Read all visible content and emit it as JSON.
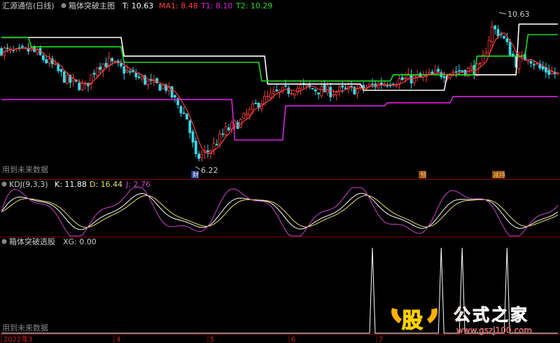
{
  "colors": {
    "background": "#000000",
    "up": "#ff3c3c",
    "down": "#38d8e8",
    "ma": "#ff4040",
    "T": "#ffffff",
    "T1": "#dd22dd",
    "T2": "#22dd22",
    "K": "#ffffff",
    "D": "#e8e060",
    "J": "#cc44cc",
    "XG": "#ffffff",
    "divider": "#800000"
  },
  "main_panel": {
    "header": {
      "stock": "汇源通信(日线)",
      "indicator": "箱体突破主图",
      "items": [
        {
          "label": "T: 10.63",
          "color": "#ffffff"
        },
        {
          "label": "MA1: 8.48",
          "color": "#ff4040"
        },
        {
          "label": "T1: 8.10",
          "color": "#dd22dd"
        },
        {
          "label": "T2: 10.29",
          "color": "#22dd22"
        }
      ]
    },
    "note": "用到未来数据",
    "annotations": {
      "max_price": "10.63",
      "min_price": "6.22",
      "flag_cai": "财",
      "flag_yu": "预",
      "flag_jianchi": "减持"
    }
  },
  "kdj_panel": {
    "title": "KDJ(9,3,3)",
    "items": [
      {
        "label": "K: 11.88",
        "color": "#ffffff"
      },
      {
        "label": "D: 16.44",
        "color": "#e8e060"
      },
      {
        "label": "J: 2.76",
        "color": "#cc44cc"
      }
    ]
  },
  "xg_panel": {
    "title": "箱体突破选股",
    "items": [
      {
        "label": "XG: 0.00",
        "color": "#cccccc"
      }
    ],
    "note": "用到未来数据"
  },
  "time_axis": {
    "labels": [
      "2022年",
      "3",
      "4",
      "5",
      "6",
      "7"
    ]
  },
  "watermark": {
    "char": "股",
    "text": "公式之家",
    "url": "www.gszj100.com"
  },
  "chart_data": [
    {
      "type": "candlestick",
      "title": "箱体突破主图",
      "series": [
        {
          "name": "T",
          "values": [
            [
              0,
              10.2
            ],
            [
              40,
              10.2
            ],
            [
              41,
              9.6
            ],
            [
              88,
              9.6
            ],
            [
              89,
              8.7
            ],
            [
              120,
              8.7
            ],
            [
              121,
              8.5
            ],
            [
              148,
              8.5
            ],
            [
              149,
              9.0
            ],
            [
              172,
              9.0
            ],
            [
              173,
              10.63
            ],
            [
              186,
              10.63
            ]
          ]
        },
        {
          "name": "T1",
          "values": [
            [
              0,
              8.2
            ],
            [
              77,
              8.2
            ],
            [
              78,
              6.9
            ],
            [
              94,
              6.9
            ],
            [
              95,
              8.0
            ],
            [
              128,
              8.0
            ],
            [
              129,
              8.1
            ],
            [
              150,
              8.1
            ],
            [
              151,
              8.3
            ],
            [
              186,
              8.3
            ]
          ]
        },
        {
          "name": "T2",
          "values": [
            [
              0,
              10.2
            ],
            [
              9,
              10.2
            ],
            [
              10,
              9.9
            ],
            [
              40,
              9.9
            ],
            [
              41,
              9.4
            ],
            [
              86,
              9.4
            ],
            [
              87,
              8.8
            ],
            [
              106,
              8.8
            ],
            [
              107,
              8.8
            ],
            [
              130,
              8.8
            ],
            [
              131,
              9.0
            ],
            [
              158,
              9.0
            ],
            [
              159,
              9.6
            ],
            [
              175,
              9.6
            ],
            [
              176,
              10.29
            ],
            [
              186,
              10.29
            ]
          ]
        },
        {
          "name": "MA1",
          "values": "computed"
        }
      ],
      "close_path": [
        [
          0,
          9.8
        ],
        [
          5,
          9.7
        ],
        [
          10,
          9.8
        ],
        [
          17,
          9.3
        ],
        [
          22,
          8.8
        ],
        [
          28,
          8.6
        ],
        [
          32,
          9.3
        ],
        [
          36,
          9.4
        ],
        [
          44,
          9.0
        ],
        [
          50,
          8.7
        ],
        [
          55,
          8.6
        ],
        [
          62,
          7.6
        ],
        [
          65,
          6.3
        ],
        [
          70,
          6.6
        ],
        [
          75,
          7.2
        ],
        [
          80,
          7.5
        ],
        [
          86,
          8.1
        ],
        [
          92,
          8.4
        ],
        [
          100,
          8.6
        ],
        [
          110,
          8.45
        ],
        [
          120,
          8.55
        ],
        [
          130,
          8.8
        ],
        [
          140,
          8.9
        ],
        [
          150,
          9.1
        ],
        [
          160,
          9.2
        ],
        [
          164,
          10.5
        ],
        [
          167,
          10.3
        ],
        [
          172,
          9.4
        ],
        [
          176,
          9.6
        ],
        [
          180,
          9.2
        ],
        [
          186,
          9.0
        ]
      ],
      "ylim": [
        6.0,
        11.0
      ]
    },
    {
      "type": "line",
      "title": "KDJ(9,3,3)",
      "series": [
        {
          "name": "K",
          "last": 11.88
        },
        {
          "name": "D",
          "last": 16.44
        },
        {
          "name": "J",
          "last": 2.76
        }
      ],
      "ylim": [
        -10,
        110
      ]
    },
    {
      "type": "line",
      "title": "箱体突破选股",
      "series": [
        {
          "name": "XG",
          "spikes": [
            124,
            147,
            154,
            169
          ],
          "last": 0.0
        }
      ],
      "ylim": [
        0,
        1
      ]
    }
  ]
}
